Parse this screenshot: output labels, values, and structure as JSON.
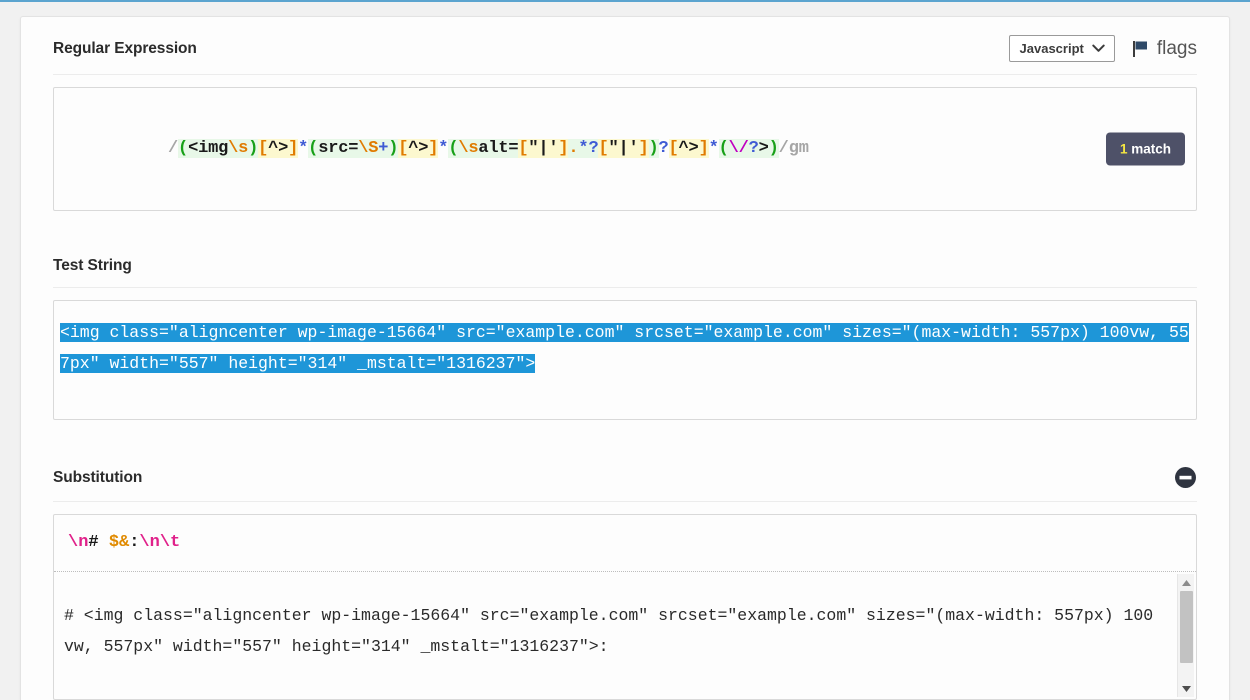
{
  "regex_section": {
    "title": "Regular Expression",
    "language": "Javascript",
    "flags_label": "flags",
    "match_count": "1",
    "match_label": "match",
    "open_delimiter": "/",
    "close_delimiter": "/",
    "flags": "gm",
    "pattern": "(<img\\s)[^>]*(src=\\S+)[^>]*(\\salt=[\"|'].*?[\"|'])?[^>]*(\\/?>)",
    "tokens": [
      {
        "t": "(",
        "c": "paren",
        "g": "grp"
      },
      {
        "t": "<img",
        "c": "lit",
        "g": "grp"
      },
      {
        "t": "\\s",
        "c": "esc",
        "g": "grp"
      },
      {
        "t": ")",
        "c": "paren",
        "g": "grp"
      },
      {
        "t": "[",
        "c": "brk",
        "g": "cls"
      },
      {
        "t": "^>",
        "c": "lit",
        "g": "cls"
      },
      {
        "t": "]",
        "c": "brk",
        "g": "cls"
      },
      {
        "t": "*",
        "c": "quant",
        "g": ""
      },
      {
        "t": "(",
        "c": "paren",
        "g": "grp"
      },
      {
        "t": "src=",
        "c": "lit",
        "g": "grp"
      },
      {
        "t": "\\S",
        "c": "esc",
        "g": "grp"
      },
      {
        "t": "+",
        "c": "quant",
        "g": "grp"
      },
      {
        "t": ")",
        "c": "paren",
        "g": "grp"
      },
      {
        "t": "[",
        "c": "brk",
        "g": "cls"
      },
      {
        "t": "^>",
        "c": "lit",
        "g": "cls"
      },
      {
        "t": "]",
        "c": "brk",
        "g": "cls"
      },
      {
        "t": "*",
        "c": "quant",
        "g": ""
      },
      {
        "t": "(",
        "c": "paren",
        "g": "grp"
      },
      {
        "t": "\\s",
        "c": "esc",
        "g": "grp"
      },
      {
        "t": "alt=",
        "c": "lit",
        "g": "grp"
      },
      {
        "t": "[",
        "c": "brk",
        "g": "cls"
      },
      {
        "t": "\"|'",
        "c": "lit",
        "g": "cls"
      },
      {
        "t": "]",
        "c": "brk",
        "g": "cls"
      },
      {
        "t": ".",
        "c": "esc",
        "g": "grp"
      },
      {
        "t": "*",
        "c": "quant",
        "g": "grp"
      },
      {
        "t": "?",
        "c": "quant",
        "g": "grp"
      },
      {
        "t": "[",
        "c": "brk",
        "g": "cls"
      },
      {
        "t": "\"|'",
        "c": "lit",
        "g": "cls"
      },
      {
        "t": "]",
        "c": "brk",
        "g": "cls"
      },
      {
        "t": ")",
        "c": "paren",
        "g": "grp"
      },
      {
        "t": "?",
        "c": "quant",
        "g": ""
      },
      {
        "t": "[",
        "c": "brk",
        "g": "cls"
      },
      {
        "t": "^>",
        "c": "lit",
        "g": "cls"
      },
      {
        "t": "]",
        "c": "brk",
        "g": "cls"
      },
      {
        "t": "*",
        "c": "quant",
        "g": ""
      },
      {
        "t": "(",
        "c": "paren",
        "g": "grp"
      },
      {
        "t": "\\/",
        "c": "s-esc-magenta",
        "g": "grp"
      },
      {
        "t": "?",
        "c": "quant",
        "g": "grp"
      },
      {
        "t": ">",
        "c": "lit",
        "g": "grp"
      },
      {
        "t": ")",
        "c": "paren",
        "g": "grp"
      }
    ]
  },
  "test_section": {
    "title": "Test String",
    "text": "<img class=\"aligncenter wp-image-15664\" src=\"example.com\" srcset=\"example.com\" sizes=\"(max-width: 557px) 100vw, 557px\" width=\"557\" height=\"314\" _mstalt=\"1316237\">",
    "highlight_color": "#1e96d8"
  },
  "substitution_section": {
    "title": "Substitution",
    "tokens": [
      {
        "t": "\\n",
        "c": "s-esc"
      },
      {
        "t": "#",
        "c": "s-txt"
      },
      {
        "t": " ",
        "c": "s-txt"
      },
      {
        "t": "$&",
        "c": "s-ref"
      },
      {
        "t": ":",
        "c": "s-txt"
      },
      {
        "t": "\\n",
        "c": "s-esc"
      },
      {
        "t": "\\t",
        "c": "s-esc"
      }
    ],
    "pattern": "\\n# $&:\\n\\t",
    "result": "# <img class=\"aligncenter wp-image-15664\" src=\"example.com\" srcset=\"example.com\" sizes=\"(max-width: 557px) 100vw, 557px\" width=\"557\" height=\"314\" _mstalt=\"1316237\">:"
  }
}
